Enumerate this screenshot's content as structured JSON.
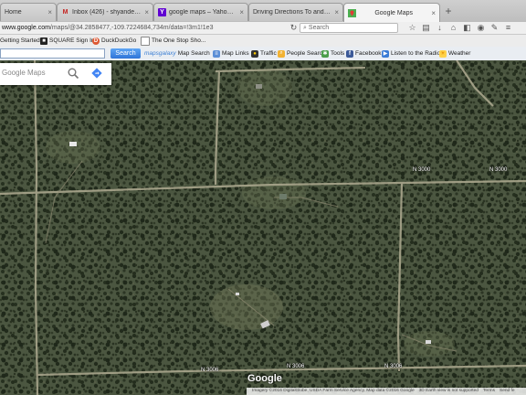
{
  "tabs": [
    {
      "title": "Home",
      "favicon": "home-icon",
      "active": false
    },
    {
      "title": "Inbox (426) - shyander@g...",
      "favicon": "gmail-icon",
      "active": false
    },
    {
      "title": "google maps – Yahoo Sea...",
      "favicon": "yahoo-icon",
      "active": false
    },
    {
      "title": "Driving Directions To and Fro...",
      "favicon": "blank-page-icon",
      "active": false
    },
    {
      "title": "Google Maps",
      "favicon": "google-maps-icon",
      "active": true
    }
  ],
  "nav": {
    "url_host": "www.google.com",
    "url_path": "/maps/@34.2858477,-109.7224684,734m/data=!3m1!1e3",
    "search_placeholder": "Search"
  },
  "bookmarks": [
    {
      "label": "Getting Started",
      "icon": "firefox-icon"
    },
    {
      "label": "SQUARE Sign In",
      "icon": "square-icon"
    },
    {
      "label": "DuckDuckGo",
      "icon": "duckduckgo-icon"
    },
    {
      "label": "The One Stop Sho...",
      "icon": "page-icon"
    }
  ],
  "toolbar": {
    "search_button": "Search",
    "items": [
      {
        "label": "Map Search",
        "brand": "mapsgalaxy",
        "icon": "mapsgalaxy-icon"
      },
      {
        "label": "Map Links",
        "icon": "map-links-icon"
      },
      {
        "label": "Traffic",
        "icon": "traffic-icon"
      },
      {
        "label": "People Search",
        "icon": "people-search-icon"
      },
      {
        "label": "Tools",
        "icon": "tools-icon"
      },
      {
        "label": "Facebook",
        "icon": "facebook-icon"
      },
      {
        "label": "Listen to the Radio",
        "icon": "radio-icon"
      },
      {
        "label": "Weather",
        "icon": "weather-icon"
      }
    ]
  },
  "maps_panel": {
    "placeholder": "Google Maps"
  },
  "road_labels": [
    {
      "text": "N 3000",
      "id": "road-label-n3000-east"
    },
    {
      "text": "N 3000",
      "id": "road-label-n3000-center"
    },
    {
      "text": "N 3006",
      "id": "road-label-n3006"
    },
    {
      "text": "N 3006",
      "id": "road-label-n3006-east"
    },
    {
      "text": "N 3006",
      "id": "road-label-n3006-south"
    }
  ],
  "footer": {
    "logo": "Google",
    "attribution": "Imagery ©2016 DigitalGlobe, USDA Farm Service Agency, Map data ©2016 Google",
    "earth_view": "3D Earth view is not supported",
    "terms": "Terms",
    "feedback": "Send fe"
  },
  "colors": {
    "terrain": "#3f4a34",
    "clearing": "#6e7556",
    "road": "#a9a58c",
    "search_button": "#2f74d8"
  }
}
